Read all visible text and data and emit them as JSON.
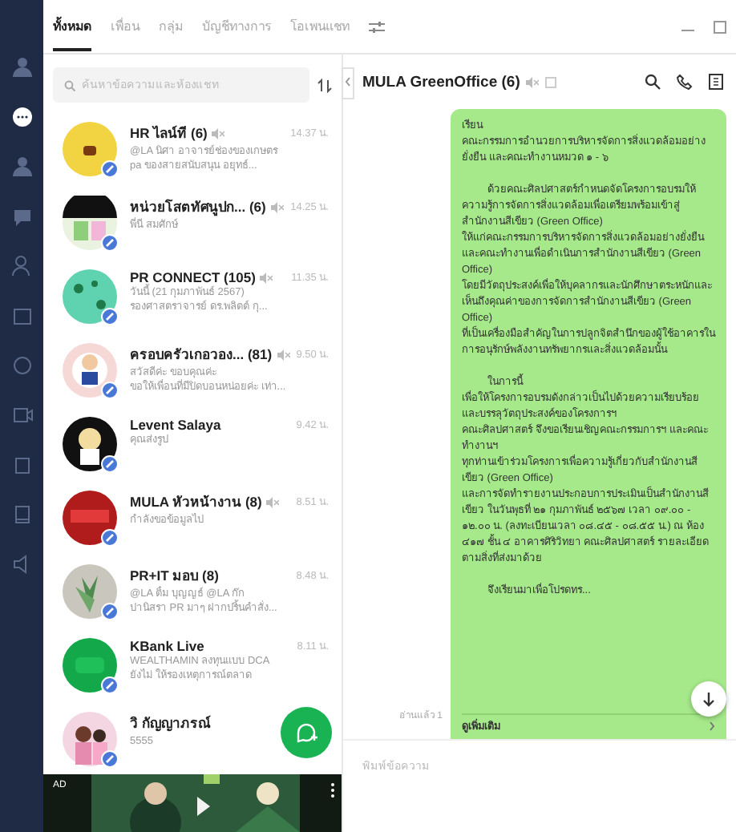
{
  "tabs": [
    {
      "label": "ทั้งหมด",
      "selected": true
    },
    {
      "label": "เพื่อน",
      "selected": false
    },
    {
      "label": "กลุ่ม",
      "selected": false
    },
    {
      "label": "บัญชีทางการ",
      "selected": false
    },
    {
      "label": "โอเพนแชท",
      "selected": false
    }
  ],
  "search": {
    "placeholder": "ค้นหาข้อความและห้องแชท"
  },
  "chats": [
    {
      "name": "HR ไลน์ที (6)",
      "muted": true,
      "time": "14.37 น.",
      "preview": [
        "@LA นิศา อาจารย์ช่องของเกษตร",
        "pa ของสายสนับสนุน อยุทธ์..."
      ]
    },
    {
      "name": "หน่วยโสตทัศนูปก... (6)",
      "muted": true,
      "time": "14.25 น.",
      "preview": [
        "พี่นี สมศักษ์"
      ]
    },
    {
      "name": "PR CONNECT (105)",
      "muted": true,
      "time": "11.35 น.",
      "preview": [
        "วันนี้ (21 กุมภาพันธ์ 2567)",
        "รองศาสตราจารย์ ดร.พลิตต์ กุ..."
      ]
    },
    {
      "name": "ครอบครัวเกอวอง... (81)",
      "muted": true,
      "time": "9.50 น.",
      "preview": [
        "สวัสดีค่ะ ขอบคุณค่ะ",
        "ขอให้เพื่อนที่มีปิดบอนหน่อยค่ะ เท่า..."
      ]
    },
    {
      "name": "Levent Salaya",
      "muted": false,
      "time": "9.42 น.",
      "preview": [
        "คุณส่งรูป"
      ]
    },
    {
      "name": "MULA หัวหน้างาน (8)",
      "muted": true,
      "time": "8.51 น.",
      "preview": [
        "กำลังขอข้อมูลไป"
      ]
    },
    {
      "name": "PR+IT มอบ (8)",
      "muted": false,
      "time": "8.48 น.",
      "preview": [
        "@LA ติ๋ม บุญญธ์ @LA ก๊ก",
        "ปานิสรา PR มาๆ ฝากปริ้นคำสั่ง..."
      ]
    },
    {
      "name": "KBank Live",
      "muted": false,
      "time": "8.11 น.",
      "preview": [
        "WEALTHAMIN ลงทุนแบบ DCA",
        "ยังไม่ ให้รองเหตุการณ์ตลาด"
      ]
    },
    {
      "name": "วิ กัญญาภรณ์",
      "muted": false,
      "preview": [
        "5555"
      ]
    }
  ],
  "ad": {
    "label": "AD"
  },
  "chat": {
    "title": "MULA GreenOffice (6)",
    "muted": true,
    "message": [
      {
        "text": "เรียน",
        "indent": false
      },
      {
        "text": "คณะกรรมการอำนวยการบริหารจัดการสิ่งแวดล้อมอย่างยั่งยืน และคณะทำงานหมวด ๑ - ๖",
        "indent": false
      },
      {
        "text": "ด้วยคณะศิลปศาสตร์กำหนดจัดโครงการอบรมให้ความรู้การจัดการสิ่งแวดล้อมเพื่อเตรียมพร้อมเข้าสู่สำนักงานสีเขียว (Green Office)",
        "indent": true
      },
      {
        "text": "ให้แก่คณะกรรมการบริหารจัดการสิ่งแวดล้อมอย่างยั่งยืน และคณะทำงานเพื่อดำเนินการสำนักงานสีเขียว (Green Office)",
        "indent": false
      },
      {
        "text": "โดยมีวัตถุประสงค์เพื่อให้บุคลากรและนักศึกษาตระหนักและเห็นถึงคุณค่าของการจัดการสำนักงานสีเขียว (Green Office)",
        "indent": false
      },
      {
        "text": "ที่เป็นเครื่องมือสำคัญในการปลูกจิตสำนึกของผู้ใช้อาคารในการอนุรักษ์พลังงานทรัพยากรและสิ่งแวดล้อมนั้น",
        "indent": false
      },
      {
        "text": "ในการนี้",
        "indent": true
      },
      {
        "text": "เพื่อให้โครงการอบรมดังกล่าวเป็นไปด้วยความเรียบร้อยและบรรลุวัตถุประสงค์ของโครงการฯ",
        "indent": false
      },
      {
        "text": "คณะศิลปศาสตร์ จึงขอเรียนเชิญคณะกรรมการฯ และคณะทำงานฯ",
        "indent": false
      },
      {
        "text": "ทุกท่านเข้าร่วมโครงการเพื่อความรู้เกี่ยวกับสำนักงานสีเขียว (Green Office)",
        "indent": false
      },
      {
        "text": "และการจัดทำรายงานประกอบการประเมินเป็นสำนักงานสีเขียว ในวันพุธที่ ๒๑ กุมภาพันธ์ ๒๕๖๗ เวลา ๐๙.๐๐ - ๑๒.๐๐ น. (ลงทะเบียนเวลา ๐๘.๔๕ - ๐๘.๕๕ น.) ณ ห้อง ๔๑๗ ชั้น ๔ อาคารศิริวิทยา คณะศิลปศาสตร์ รายละเอียดตามสิ่งที่ส่งมาด้วย",
        "indent": false
      },
      {
        "text": "จึงเรียนมาเพื่อโปรดทร...",
        "indent": true
      }
    ],
    "more": "ดูเพิ่มเติม",
    "read": "อ่านแล้ว 1"
  },
  "composer": {
    "placeholder": "พิมพ์ข้อความ"
  }
}
